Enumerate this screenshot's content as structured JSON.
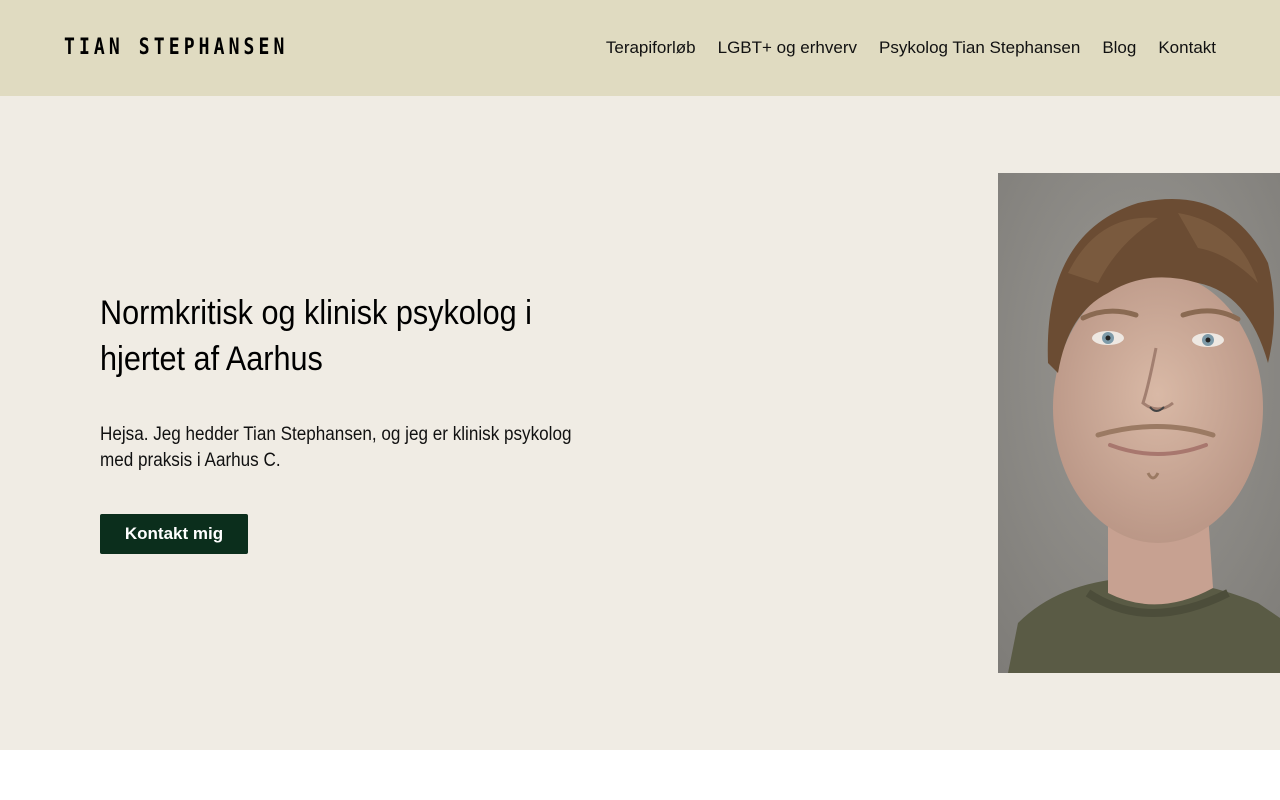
{
  "header": {
    "logo_text": "TIAN STEPHANSEN",
    "nav": [
      {
        "label": "Terapiforløb"
      },
      {
        "label": "LGBT+ og erhverv"
      },
      {
        "label": "Psykolog Tian Stephansen"
      },
      {
        "label": "Blog"
      },
      {
        "label": "Kontakt"
      }
    ]
  },
  "hero": {
    "title": "Normkritisk og klinisk psykolog i hjertet af Aarhus",
    "text": "Hejsa. Jeg hedder Tian Stephansen, og jeg er klinisk psykolog med praksis i Aarhus C.",
    "cta_label": "Kontakt mig",
    "portrait_icon": "portrait-photo"
  },
  "colors": {
    "header_bg": "#e0dbc1",
    "hero_bg": "#f0ece4",
    "cta_bg": "#0b2e1c",
    "cta_text": "#ffffff"
  }
}
